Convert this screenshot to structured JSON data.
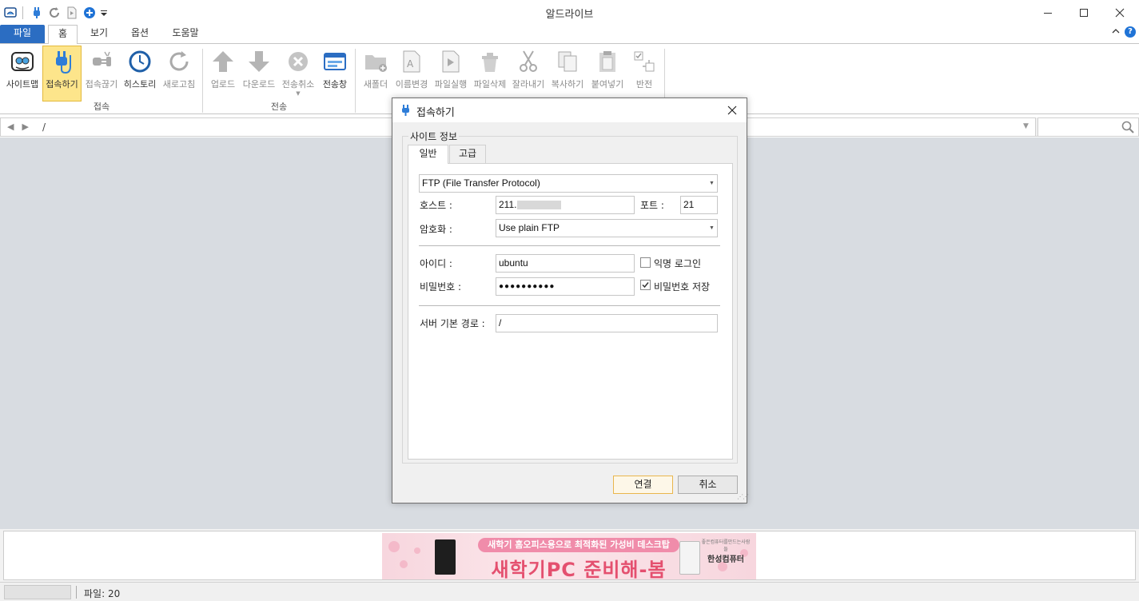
{
  "window": {
    "title": "알드라이브"
  },
  "tabs": {
    "file": "파일",
    "home": "홈",
    "view": "보기",
    "options": "옵션",
    "help": "도움말"
  },
  "ribbon": {
    "connect_group": {
      "label": "접속",
      "items": [
        "사이트맵",
        "접속하기",
        "접속끊기",
        "히스토리",
        "새로고침"
      ]
    },
    "transfer_group": {
      "label": "전송",
      "items": [
        "업로드",
        "다운로드",
        "전송취소",
        "전송창"
      ]
    },
    "file_group": {
      "items": [
        "새폴더",
        "이름변경",
        "파일실행",
        "파일삭제",
        "잘라내기",
        "복사하기",
        "붙여넣기",
        "반전"
      ]
    }
  },
  "address": {
    "path": "/"
  },
  "banner": {
    "line1": "새학기 홈오피스용으로 최적화된 가성비 데스크탑",
    "line2": "새학기PC 준비해-봄",
    "brand": "한성컴퓨터",
    "brand_small": "좋은컴퓨터를만드는사람들"
  },
  "status": {
    "files": "파일: 20"
  },
  "dialog": {
    "title": "접속하기",
    "group_label": "사이트 정보",
    "tab_general": "일반",
    "tab_advanced": "고급",
    "protocol": "FTP (File Transfer Protocol)",
    "host_label": "호스트 :",
    "host_value": "211.",
    "port_label": "포트 :",
    "port_value": "21",
    "encryption_label": "암호화 :",
    "encryption_value": "Use plain FTP",
    "id_label": "아이디 :",
    "id_value": "ubuntu",
    "anonymous_label": "익명 로그인",
    "anonymous_checked": false,
    "password_label": "비밀번호 :",
    "password_value": "●●●●●●●●●●",
    "save_password_label": "비밀번호 저장",
    "save_password_checked": true,
    "path_label": "서버 기본 경로 :",
    "path_value": "/",
    "connect_button": "연결",
    "cancel_button": "취소"
  },
  "colors": {
    "accent": "#2b6dc2",
    "selected_bg": "#fde58b",
    "content_bg": "#d8dce1"
  }
}
